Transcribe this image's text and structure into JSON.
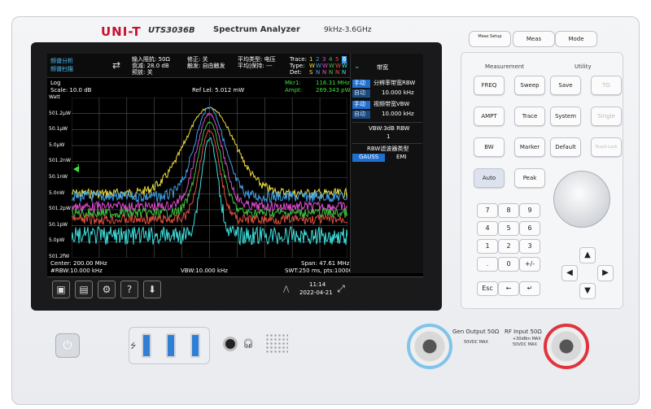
{
  "device": {
    "brand": "UNI-T",
    "model": "UTS3036B",
    "title": "Spectrum Analyzer",
    "freq_range": "9kHz-3.6GHz"
  },
  "screen": {
    "mode_line1": "频谱分析",
    "mode_line2": "频谱扫描",
    "hdr_in_imp": "输入阻抗: 50Ω",
    "hdr_atten": "衰减: 28.0 dB",
    "hdr_preamp": "预放: 关",
    "hdr_corr": "修正: 关",
    "hdr_trig": "触发: 自由触发",
    "hdr_avgtype": "平均类型: 电压",
    "hdr_avghold": "平均|保持: ---",
    "trace_label": "Trace:",
    "trace_nums": [
      "1",
      "2",
      "3",
      "4",
      "5",
      "6"
    ],
    "type_label": "Type:",
    "type_vals": [
      "W",
      "W",
      "W",
      "W",
      "W",
      "W"
    ],
    "det_label": "Det:",
    "det_vals": [
      "S",
      "N",
      "N",
      "N",
      "N",
      "N"
    ],
    "scale_type": "Log",
    "scale": "Scale: 10.0 dB",
    "ref_level": "Ref Lel: 5.012 mW",
    "mkr_label": "Mkr1:",
    "mkr_freq": "116.31 MHz",
    "ampt_label": "Ampt:",
    "mkr_ampt": "269.343 pW",
    "y_ticks": [
      "Watt",
      "501.2μW",
      "50.1μW",
      "5.0μW",
      "501.2nW",
      "50.1nW",
      "5.0nW",
      "501.2pW",
      "50.1pW",
      "5.0pW",
      "501.2fW"
    ],
    "marker_num": "1",
    "center": "Center: 200.00 MHz",
    "rbw": "#RBW:10.000 kHz",
    "vbw": "VBW:10.000 kHz",
    "span": "Span: 47.61 MHz",
    "swt": "SWT:250 ms, pts:10000",
    "time": "11:14",
    "date": "2022-04-21",
    "toolbar_icons": [
      "screenshot-icon",
      "folder-icon",
      "settings-icon",
      "help-icon",
      "download-icon"
    ]
  },
  "right_panel": {
    "title": "带宽",
    "rbw_manual": "手动",
    "rbw_auto": "自动",
    "rbw_label": "分辨率带宽RBW",
    "rbw_value": "10.000 kHz",
    "vbw_manual": "手动",
    "vbw_auto": "自动",
    "vbw_label": "视频带宽VBW",
    "vbw_value": "10.000 kHz",
    "ratio_label": "VBW:3dB RBW",
    "ratio_value": "1",
    "filter_label": "RBW滤波器类型",
    "filter_gauss": "GAUSS",
    "filter_emi": "EMI"
  },
  "front_panel": {
    "top_keys": [
      "Meas Setup",
      "Meas",
      "Mode"
    ],
    "group_measurement": "Measurement",
    "group_utility": "Utility",
    "meas_keys": [
      "FREQ",
      "Sweep",
      "AMPT",
      "Trace",
      "BW",
      "Marker",
      "Auto",
      "Peak"
    ],
    "util_keys": [
      "Save",
      "TG",
      "System",
      "Single",
      "Default",
      "Touch Lock"
    ],
    "num_keys": [
      "7",
      "8",
      "9",
      "4",
      "5",
      "6",
      "1",
      "2",
      "3",
      ".",
      "0",
      "+/-"
    ],
    "edit_keys": [
      "Esc",
      "←",
      "↵"
    ],
    "arrow_keys": [
      "▲",
      "◀",
      "▶",
      "▼"
    ],
    "gen_output": "Gen Output 50Ω",
    "gen_warn": "50VDC MAX",
    "rf_input": "RF Input  50Ω",
    "rf_warn1": "+30dBm MAX",
    "rf_warn2": "50VDC MAX"
  },
  "chart_data": {
    "type": "line",
    "title": "",
    "xlabel": "",
    "ylabel": "Watt",
    "x_range_mhz": [
      176.195,
      223.805
    ],
    "series": [
      {
        "color": "#f0e040",
        "peak_x": 200.0
      },
      {
        "color": "#3fa0e8",
        "peak_x": 200.0
      },
      {
        "color": "#e04bd0",
        "peak_x": 200.0
      },
      {
        "color": "#40c040",
        "peak_x": 200.0
      },
      {
        "color": "#e05040",
        "peak_x": 200.0
      },
      {
        "color": "#40e0e0",
        "peak_x": 200.0
      }
    ]
  }
}
